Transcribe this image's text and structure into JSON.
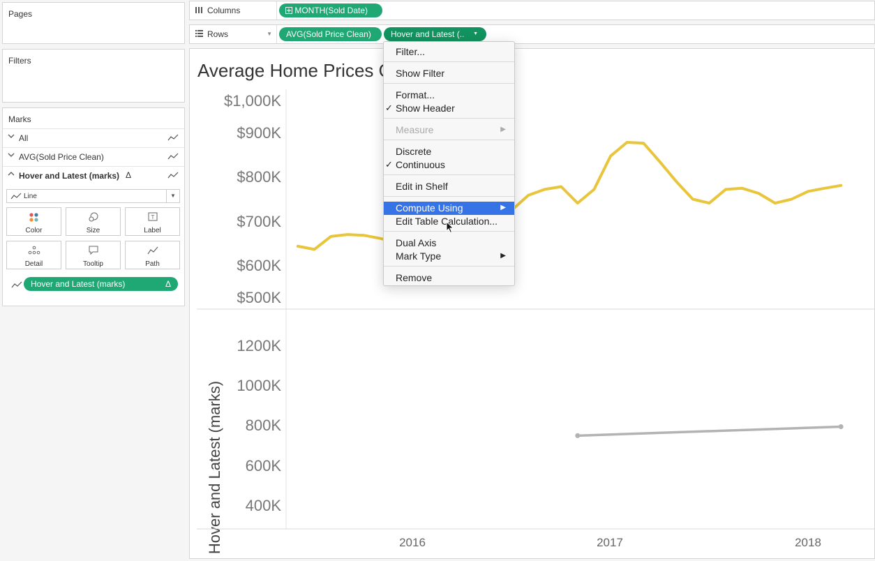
{
  "pages": {
    "title": "Pages"
  },
  "filters": {
    "title": "Filters"
  },
  "marks": {
    "title": "Marks",
    "rows": [
      {
        "label": "All"
      },
      {
        "label": "AVG(Sold Price Clean)"
      },
      {
        "label": "Hover and Latest (marks)",
        "delta": "Δ"
      }
    ],
    "mark_type": "Line",
    "cards": [
      "Color",
      "Size",
      "Label",
      "Detail",
      "Tooltip",
      "Path"
    ],
    "pill": {
      "label": "Hover and Latest (marks)",
      "delta": "Δ"
    }
  },
  "shelves": {
    "columns": {
      "label": "Columns",
      "pill": "MONTH(Sold Date)"
    },
    "rows": {
      "label": "Rows",
      "pill1": "AVG(Sold Price Clean)",
      "pill2": "Hover and Latest (..",
      "pill2_arrow": "▼"
    }
  },
  "chart": {
    "title": "Average Home Prices Over Time",
    "upper_y_ticks": [
      "$1,000K",
      "$900K",
      "$800K",
      "$700K",
      "$600K",
      "$500K"
    ],
    "lower_y_ticks": [
      "1200K",
      "1000K",
      "800K",
      "600K",
      "400K"
    ],
    "lower_y_title": "Hover and Latest (marks)",
    "x_ticks": [
      "2016",
      "2017",
      "2018"
    ],
    "colors": {
      "line": "#e8c53a",
      "lower_line": "#b3b3b3"
    }
  },
  "chart_data": [
    {
      "type": "line",
      "title": "Average Home Prices Over Time",
      "ylabel": "",
      "ylim": [
        500,
        1000
      ],
      "x": [
        "2015-06",
        "2015-07",
        "2015-08",
        "2015-09",
        "2015-10",
        "2015-11",
        "2015-12",
        "2016-01",
        "2016-02",
        "2016-03",
        "2016-04",
        "2016-05",
        "2016-06",
        "2016-07",
        "2016-08",
        "2016-09",
        "2016-10",
        "2016-11",
        "2016-12",
        "2017-01",
        "2017-02",
        "2017-03",
        "2017-04",
        "2017-05",
        "2017-06",
        "2017-07",
        "2017-08",
        "2017-09",
        "2017-10",
        "2017-11",
        "2017-12",
        "2018-01",
        "2018-02",
        "2018-03"
      ],
      "values": [
        630,
        622,
        655,
        660,
        658,
        650,
        640,
        615,
        640,
        660,
        700,
        725,
        720,
        722,
        760,
        775,
        782,
        740,
        775,
        860,
        895,
        893,
        845,
        795,
        750,
        740,
        775,
        778,
        765,
        740,
        750,
        770,
        778,
        785
      ],
      "series_unit": "K USD"
    },
    {
      "type": "line",
      "ylabel": "Hover and Latest (marks)",
      "ylim": [
        400,
        1300
      ],
      "x": [
        "2016-11",
        "2018-03"
      ],
      "values": [
        755,
        800
      ]
    }
  ],
  "menu": {
    "items": [
      {
        "label": "Filter..."
      },
      {
        "label": "Show Filter"
      },
      {
        "label": "Format..."
      },
      {
        "label": "Show Header",
        "check": "✓"
      },
      {
        "label": "Measure",
        "sub": "▶"
      },
      {
        "label": "Discrete"
      },
      {
        "label": "Continuous",
        "check": "✓"
      },
      {
        "label": "Edit in Shelf"
      },
      {
        "label": "Compute Using",
        "sub": "▶"
      },
      {
        "label": "Edit Table Calculation..."
      },
      {
        "label": "Dual Axis"
      },
      {
        "label": "Mark Type",
        "sub": "▶"
      },
      {
        "label": "Remove"
      }
    ]
  }
}
